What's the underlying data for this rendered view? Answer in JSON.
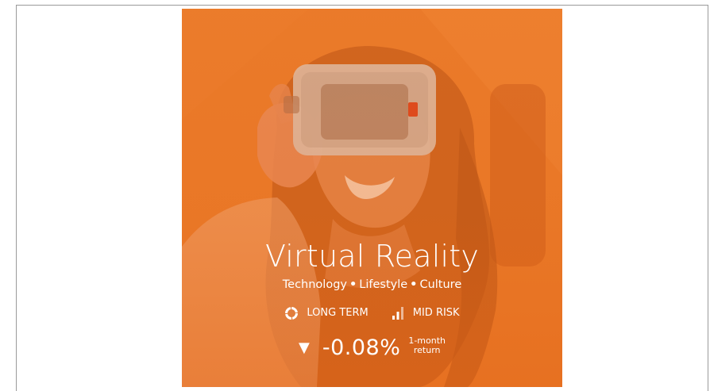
{
  "card": {
    "title": "Virtual Reality",
    "tags": [
      "Technology",
      "Lifestyle",
      "Culture"
    ],
    "tag_separator": "•",
    "horizon": {
      "label": "LONG TERM",
      "icon": "circle-segments-icon"
    },
    "risk": {
      "label": "MID RISK",
      "icon": "signal-bars-icon",
      "level": "mid"
    },
    "performance": {
      "direction_icon": "triangle-down-icon",
      "arrow_glyph": "▼",
      "value": "-0.08%",
      "caption_line1": "1-month",
      "caption_line2": "return"
    },
    "photo_subject": "woman-wearing-vr-headset",
    "colors": {
      "accent": "#e8782a",
      "text": "#ffffff"
    }
  }
}
